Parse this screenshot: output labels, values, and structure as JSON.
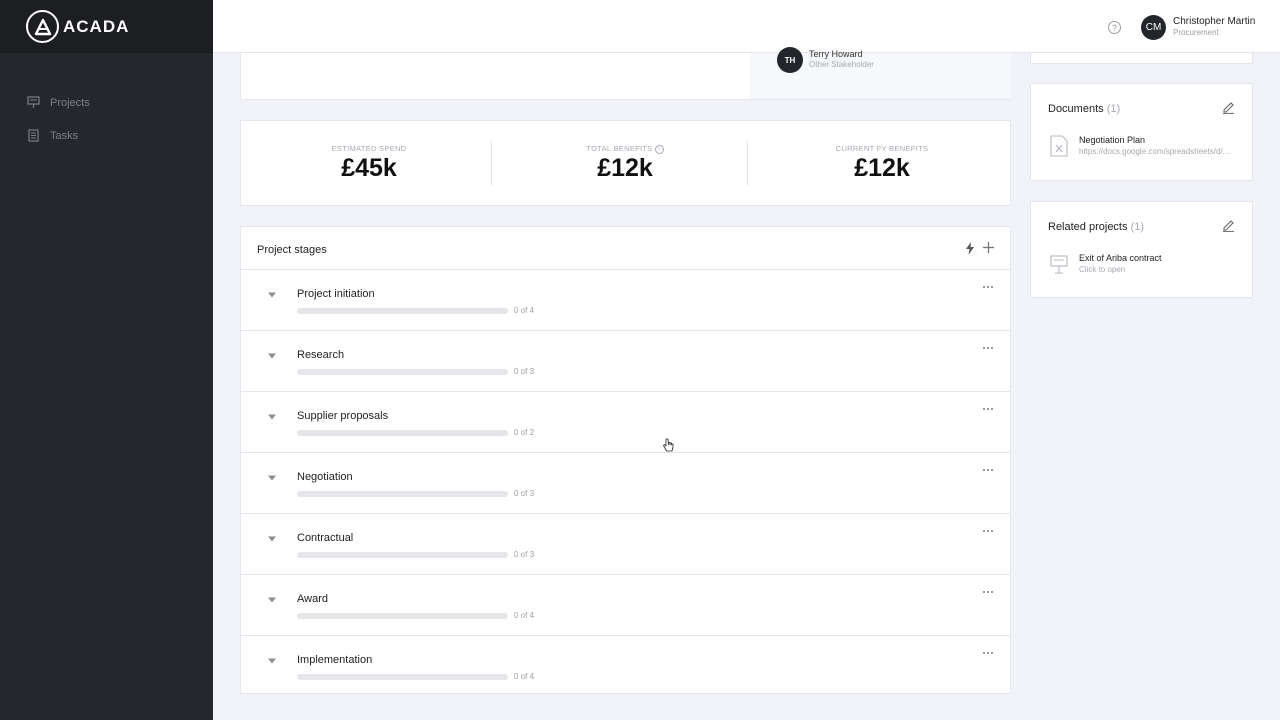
{
  "brand": {
    "name": "ACADA"
  },
  "nav": {
    "items": [
      {
        "label": "Projects",
        "icon": "presentation-board-icon"
      },
      {
        "label": "Tasks",
        "icon": "document-list-icon"
      }
    ]
  },
  "topbar": {
    "help_icon": "?",
    "user": {
      "initials": "CM",
      "name": "Christopher Martin",
      "role": "Procurement"
    }
  },
  "stakeholder": {
    "initials": "TH",
    "name": "Terry Howard",
    "role": "Other Stakeholder"
  },
  "stats": [
    {
      "label": "ESTIMATED SPEND",
      "value": "£45k"
    },
    {
      "label": "TOTAL BENEFITS",
      "value": "£12k"
    },
    {
      "label": "CURRENT FY BENEFITS",
      "value": "£12k"
    }
  ],
  "stages": {
    "title": "Project stages",
    "items": [
      {
        "name": "Project initiation",
        "count": "0 of 4",
        "progress": 0
      },
      {
        "name": "Research",
        "count": "0 of 3",
        "progress": 0
      },
      {
        "name": "Supplier proposals",
        "count": "0 of 2",
        "progress": 0
      },
      {
        "name": "Negotiation",
        "count": "0 of 3",
        "progress": 0
      },
      {
        "name": "Contractual",
        "count": "0 of 3",
        "progress": 0
      },
      {
        "name": "Award",
        "count": "0 of 4",
        "progress": 0
      },
      {
        "name": "Implementation",
        "count": "0 of 4",
        "progress": 0
      }
    ]
  },
  "documents": {
    "title": "Documents",
    "count": "(1)",
    "items": [
      {
        "title": "Negotiation Plan",
        "subtitle": "https://docs.google.com/spreadsheets/d/..."
      }
    ]
  },
  "related": {
    "title": "Related projects",
    "count": "(1)",
    "items": [
      {
        "title": "Exit of Ariba contract",
        "subtitle": "Click to open"
      }
    ]
  },
  "colors": {
    "sidebar": "#24272c",
    "background": "#f1f3f9",
    "accent": "#22252a"
  }
}
